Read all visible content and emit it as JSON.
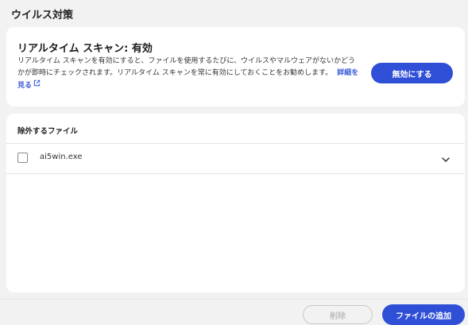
{
  "page": {
    "title": "ウイルス対策"
  },
  "realtime": {
    "title": "リアルタイム スキャン: 有効",
    "description": "リアルタイム スキャンを有効にすると、ファイルを使用するたびに、ウイルスやマルウェアがないかどうかが即時にチェックされます。リアルタイム スキャンを常に有効にしておくことをお勧めします。",
    "learn_more": "詳細を見る",
    "disable_button": "無効にする"
  },
  "exclusions": {
    "header": "除外するファイル",
    "files": [
      {
        "name": "ai5win.exe",
        "checked": false
      }
    ]
  },
  "footer": {
    "delete_button": "削除",
    "add_button": "ファイルの追加"
  },
  "colors": {
    "accent": "#2f4fd7",
    "link": "#3a5bd9",
    "background": "#f2f2f2"
  },
  "icons": {
    "external_link": "external-link-icon",
    "expand": "chevron-down-icon"
  }
}
